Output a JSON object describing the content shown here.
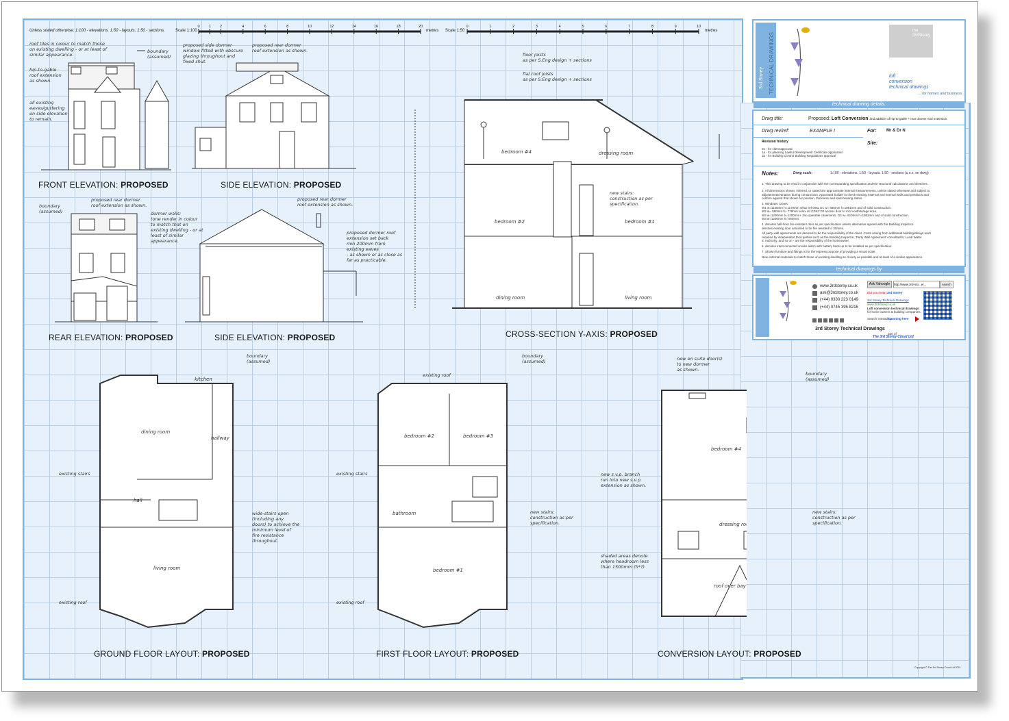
{
  "scale_bar": {
    "note": "Unless stated otherwise: 1:100 - elevations. 1:50 - layouts. 1:50 - sections.",
    "scale1_label": "Scale 1:100",
    "scale1_ticks": [
      "0",
      "1",
      "2",
      "4",
      "6",
      "8",
      "10",
      "12",
      "14",
      "16",
      "18",
      "20"
    ],
    "scale2_label": "Scale 1:50",
    "scale2_ticks": [
      "0",
      "1",
      "2",
      "3",
      "4",
      "5",
      "6",
      "7",
      "8",
      "9",
      "10"
    ],
    "units": "metres"
  },
  "drawings": {
    "front_elevation": {
      "title": "FRONT ELEVATION: ",
      "status": "PROPOSED"
    },
    "side_elevation_1": {
      "title": "SIDE ELEVATION: ",
      "status": "PROPOSED"
    },
    "rear_elevation": {
      "title": "REAR ELEVATION: ",
      "status": "PROPOSED"
    },
    "side_elevation_2": {
      "title": "SIDE ELEVATION: ",
      "status": "PROPOSED"
    },
    "cross_section": {
      "title": "CROSS-SECTION Y-AXIS: ",
      "status": "PROPOSED"
    },
    "ground_floor": {
      "title": "GROUND FLOOR LAYOUT: ",
      "status": "PROPOSED"
    },
    "first_floor": {
      "title": "FIRST FLOOR LAYOUT: ",
      "status": "PROPOSED"
    },
    "conversion": {
      "title": "CONVERSION LAYOUT: ",
      "status": "PROPOSED"
    }
  },
  "annotations": {
    "roof_tiles": "roof tiles in colour to match those\non existing dwelling - or at least of\nsimilar appearance.",
    "hip_to_gable": "hip-to-gable\nroof extension\nas shown.",
    "all_existing": "all existing\neaves/guttering\non side elevation\nto remain.",
    "boundary_assumed": "boundary\n(assumed)",
    "side_dormer_window": "proposed side dormer\nwindow fitted with obscure\nglazing throughout and\nfixed shut.",
    "rear_dormer_shown": "proposed rear dormer\nroof extension as shown.",
    "dormer_walls": "dormer walls:\ntone render in colour\nto match that on\nexisting dwelling - or at\nleast of similar\nappearance.",
    "dormer_setback": "proposed dormer roof\nextension set back\nmin 200mm from\nexisting eaves\n- as shown or as close as\nfar as practicable.",
    "floor_joists": "floor joists\nas per S.Eng design + sections",
    "flat_roof_joists": "flat roof joists\nas per S.Eng design + sections",
    "new_stairs": "new stairs:\nconstruction as per\nspecification.",
    "wide_stairs": "wide-stairs open\n(including any\ndoors) to achieve the\nminimum level of\nfire resistance\nthroughout.",
    "existing_stairs": "existing stairs",
    "existing_roof": "existing roof",
    "new_en_suite": "new en suite door(s)\nto new dormer\nas shown.",
    "new_ss_branch": "new s.v.p. branch\nrun into new s.v.p.\nextension as shown.",
    "shaded_areas": "shaded areas denote\nwhere headroom less\nthan 1500mm (h*?)."
  },
  "rooms": {
    "bedroom4": "bedroom #4",
    "dressing_room": "dressing room",
    "bedroom2": "bedroom #2",
    "bedroom1": "bedroom #1",
    "bedroom3": "bedroom #3",
    "dining_room": "dining room",
    "living_room": "living room",
    "kitchen": "kitchen",
    "hallway": "hallway",
    "hall": "hall",
    "bathroom": "bathroom",
    "bed": "bed",
    "roof_over_bay": "roof over bay",
    "room": "room"
  },
  "title_block": {
    "logo_text_1": "3rd Storey",
    "logo_text_2": "TECHNICAL DRAWINGS",
    "logo_small": "the\n3rdStorey",
    "tagline_1": "loft",
    "tagline_2": "conversion",
    "tagline_3": "technical drawings",
    "tagline_4": "... for homes and business.",
    "details_header": "technical drawing details:",
    "drwg_title_label": "Drwg title:",
    "drwg_title_value_prefix": "Proposed: ",
    "drwg_title_value_main": "Loft Conversion",
    "drwg_title_value_suffix": "and addition of hip-to-gable + rear dormer roof extension.",
    "drwg_rev_label": "Drwg rev/ref:",
    "drwg_rev_value": "EXAMPLE I",
    "for_label": "For:",
    "for_value": "Mr & Dr N",
    "revision_history_label": "Revision history",
    "revision_lines": [
      "01 - for client approval",
      "1a - for planning Lawful Development Certificate application",
      "1b - for Building Control Building Regulations approval"
    ],
    "site_label": "Site:",
    "notes_label": "Notes:",
    "drwg_scale_label": "Drwg scale:",
    "drwg_scale_value": "1:100 - elevations. 1:50 - layouts. 1:50 - sections (u.o.s. on drwg)",
    "note_lines": [
      "1.  This drawing to be read in conjunction with the corresponding specification and the structural calculations and sketches.",
      "2.  All dimensions shown, inferred, or stated are approximate internal measurements, unless stated otherwise and subject to",
      "     adjustments/variation during construction. Appointed builder to check existing external and internal walls and partitions and",
      "     confirm against that shown for position, thickness and load-bearing status.",
      "3.  Windows:                                                              Doors:",
      "     W1  w=1145mm h=1170mm velux ref 006L                         D1  w=   686mm h=1981mm and of solid construction.",
      "     W2  w=   550mm h=   778mm velux ref CDK2                      D2  access door to roof void/storage area.",
      "     W3  w=1200mm h=1200mm+ 2no operable casements.     D3  w=   610mm h=1981mm and of solid construction.",
      "     W3  w=1200mm h=   900mm.",
      "4.  denotes half-hour fire-resistant door as per specification unless alternative agreed with the Building Inspector.",
      "     denotes existing door assumed to be fire resisted to 30mins.",
      "     All party wall agreements are deemed to be the responsibility of the client. Costs arising from additional building/design work",
      "     required by independent third parties such as the Building Inspector, 'Party Wall Agreement' consultant/s, Local Water",
      "5.  Authority, and so on - are the responsibility of the homeowner.",
      "6.  denotes interconnected smoke alarm with battery back-up to be installed as per specification.",
      "7.  Shown furniture and fittings is for the express purpose of providing a visual scale.",
      "     New external materials to match those on existing dwelling as closely as possible and at least of a similar appearance."
    ],
    "by_header": "technical drawings by",
    "web": "www.3rdstorey.co.uk",
    "email": "ask@3rdstorey.co.uk",
    "phone1": "(+44) 0330 223 0149",
    "phone2": "(+44) 0745 395 8215",
    "search_engine": "Ask Yahoogle",
    "search_value": "http://www.3rd-sto...er...",
    "search_button": "search",
    "did_you_mean_label": "Did you mean:",
    "did_you_mean_value": "3rd Storey",
    "result_title": "3rd Storey Technical Drawings",
    "result_url": "www.3rdstorey.co.uk",
    "result_line1": "Loft conversion technical drawings",
    "result_line2": "for home owners & building companies.",
    "scan_label": "Search instead by",
    "scan_link": "scanning here",
    "company_name": "3rd Storey Technical Drawings",
    "part_of": "part of",
    "cloud": "The 3rd Storey Cloud Ltd"
  },
  "copyright": "Copyright © The 3rd Storey Cloud Ltd 2019",
  "colors": {
    "grid_bg": "#e6f1fb",
    "grid_line": "#b9cfe6",
    "frame_blue": "#7fb2de",
    "ink": "#333333"
  }
}
